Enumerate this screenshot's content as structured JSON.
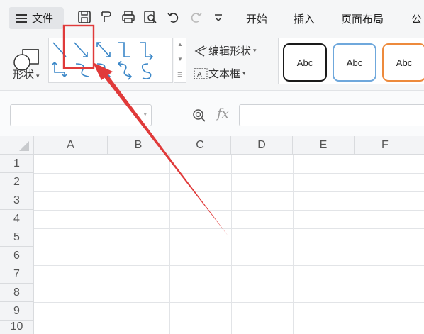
{
  "menubar": {
    "file_label": "文件",
    "tabs": [
      "开始",
      "插入",
      "页面布局",
      "公"
    ]
  },
  "ribbon": {
    "shape_label": "形状",
    "edit_shape_label": "编辑形状",
    "textbox_label": "文本框",
    "style_samples": [
      "Abc",
      "Abc",
      "Abc"
    ],
    "style_border_colors": [
      "#1a1a1a",
      "#6fa8dc",
      "#ed8a3c"
    ]
  },
  "formula_bar": {
    "fx_label": "fx",
    "name_box_value": "",
    "formula_value": ""
  },
  "grid": {
    "columns": [
      "A",
      "B",
      "C",
      "D",
      "E",
      "F"
    ],
    "rows": [
      "1",
      "2",
      "3",
      "4",
      "5",
      "6",
      "7",
      "8",
      "9",
      "10"
    ]
  },
  "annotation": {
    "highlight_color": "#e03a3a",
    "target": "elbow-arrow-connector"
  }
}
